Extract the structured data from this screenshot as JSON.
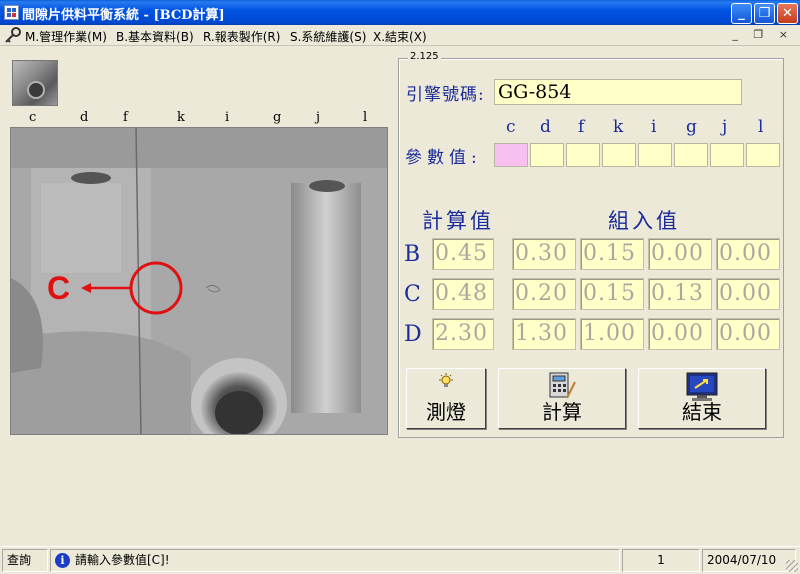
{
  "window": {
    "title": "間隙片供料平衡系統 - [BCD計算]",
    "minimize": "_",
    "restore": "❐",
    "close": "✕"
  },
  "menu": {
    "items": [
      "M.管理作業(M)",
      "B.基本資料(B)",
      "R.報表製作(R)",
      "S.系統維護(S)",
      "X.結束(X)"
    ],
    "mdi_controls": "_ ❐ ×"
  },
  "photo": {
    "column_labels": [
      "c",
      "d",
      "f",
      "k",
      "i",
      "g",
      "j",
      "l"
    ],
    "marker_label": "C"
  },
  "version": "2.125",
  "form": {
    "engine_label": "引擎號碼:",
    "engine_value": "GG-854",
    "param_label": "參數值:",
    "param_letters": [
      "c",
      "d",
      "f",
      "k",
      "i",
      "g",
      "j",
      "l"
    ],
    "calc_header": "計算值",
    "assembled_header": "組入值",
    "rows": [
      {
        "label": "B",
        "calc": "0.45",
        "assembled": [
          "0.30",
          "0.15",
          "0.00",
          "0.00"
        ]
      },
      {
        "label": "C",
        "calc": "0.48",
        "assembled": [
          "0.20",
          "0.15",
          "0.13",
          "0.00"
        ]
      },
      {
        "label": "D",
        "calc": "2.30",
        "assembled": [
          "1.30",
          "1.00",
          "0.00",
          "0.00"
        ]
      }
    ]
  },
  "buttons": {
    "light": "測燈",
    "calculate": "計算",
    "exit": "結束"
  },
  "status": {
    "mode": "查詢",
    "message": "請輸入參數值[C]!",
    "empty": "",
    "page": "1",
    "date": "2004/07/10"
  }
}
